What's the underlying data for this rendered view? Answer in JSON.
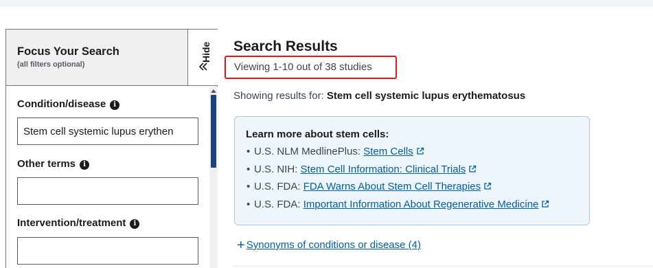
{
  "filters": {
    "title": "Focus Your Search",
    "subtitle": "(all filters optional)",
    "hide_label": "Hide",
    "fields": [
      {
        "label": "Condition/disease",
        "value": "Stem cell systemic lupus erythen",
        "placeholder": ""
      },
      {
        "label": "Other terms",
        "value": "",
        "placeholder": ""
      },
      {
        "label": "Intervention/treatment",
        "value": "",
        "placeholder": ""
      }
    ],
    "info_glyph": "i"
  },
  "results": {
    "title": "Search Results",
    "count_text": "Viewing 1-10 out of 38 studies",
    "showing_prefix": "Showing results for:",
    "showing_query": "Stem cell systemic lupus erythematosus",
    "learn_more": {
      "title": "Learn more about stem cells:",
      "items": [
        {
          "source": "U.S. NLM MedlinePlus:",
          "link": "Stem Cells"
        },
        {
          "source": "U.S. NIH:",
          "link": "Stem Cell Information: Clinical Trials"
        },
        {
          "source": "U.S. FDA:",
          "link": "FDA Warns About Stem Cell Therapies"
        },
        {
          "source": "U.S. FDA:",
          "link": "Important Information About Regenerative Medicine"
        }
      ],
      "bullet": "•",
      "icon": "external-link-icon"
    },
    "synonyms_label": "Synonyms of conditions or disease (4)",
    "synonyms_plus": "+"
  },
  "colors": {
    "link": "#005ea2",
    "highlight_box": "#e01818",
    "info_box_bg": "#eef5fb",
    "scroll_thumb": "#1a4480"
  }
}
